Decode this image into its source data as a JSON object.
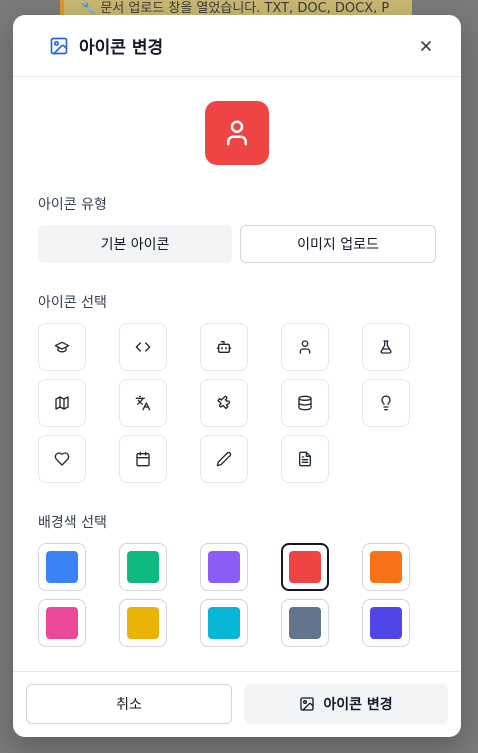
{
  "background": {
    "banner_text": "🔧 문서 업로드 창을 열었습니다. TXT, DOC, DOCX, P"
  },
  "modal": {
    "title": "아이콘 변경",
    "header_icon": "image-icon",
    "close_icon": "close-icon"
  },
  "preview": {
    "icon": "user-icon",
    "color": "#ef4444"
  },
  "icon_type": {
    "label": "아이콘 유형",
    "options": [
      "기본 아이콘",
      "이미지 업로드"
    ],
    "selected": "기본 아이콘"
  },
  "icon_select": {
    "label": "아이콘 선택",
    "icons": [
      "graduation-cap-icon",
      "code-icon",
      "bot-icon",
      "user-icon",
      "flask-icon",
      "map-icon",
      "languages-icon",
      "puzzle-icon",
      "database-icon",
      "lightbulb-icon",
      "heart-icon",
      "calendar-icon",
      "pencil-icon",
      "file-text-icon"
    ]
  },
  "color_select": {
    "label": "배경색 선택",
    "colors": [
      "#3b82f6",
      "#10b981",
      "#8b5cf6",
      "#ef4444",
      "#f97316",
      "#ec4899",
      "#eab308",
      "#06b6d4",
      "#64748b",
      "#4f46e5"
    ],
    "selected": "#ef4444"
  },
  "footer": {
    "cancel_label": "취소",
    "confirm_label": "아이콘 변경"
  }
}
